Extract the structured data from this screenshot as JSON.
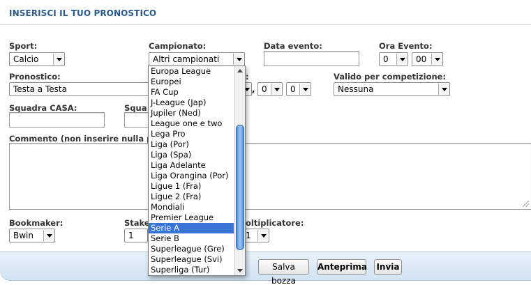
{
  "header": {
    "title": "INSERISCI IL TUO PRONOSTICO"
  },
  "row1": {
    "sport_label": "Sport:",
    "sport_value": "Calcio",
    "campionato_label": "Campionato:",
    "campionato_value": "Altri campionati",
    "data_label": "Data evento:",
    "data_value": "",
    "ora_label": "Ora Evento:",
    "ora_hour": "0",
    "ora_minute": "00"
  },
  "row2": {
    "pronostico_label": "Pronostico:",
    "pronostico_value": "Testa a Testa",
    "quota_int_partial": "",
    "quota_sep": ",",
    "quota_dec1": "0",
    "quota_dec2": "0",
    "valido_label": "Valido per competizione:",
    "valido_value": "Nessuna"
  },
  "row3": {
    "casa_label": "Squadra CASA:",
    "ospite_label_partial": "Squa"
  },
  "commento": {
    "label": "Commento (non inserire nulla pe"
  },
  "row4": {
    "bookmaker_label": "Bookmaker:",
    "bookmaker_value": "Bwin",
    "stake_label_partial": "Stake",
    "stake_value": "1",
    "molt_label_partial": "oltiplicatore:",
    "molt_value": "1"
  },
  "footer": {
    "salva_bozza": "Salva bozza",
    "anteprima": "Anteprima",
    "invia": "Invia"
  },
  "dropdown": {
    "items": [
      "Europa League",
      "Europei",
      "FA Cup",
      "J-League (Jap)",
      "Jupiler (Ned)",
      "League one e two",
      "Lega Pro",
      "Liga (Por)",
      "Liga (Spa)",
      "Liga Adelante",
      "Liga Orangina (Por)",
      "Ligue 1 (Fra)",
      "Ligue 2 (Fra)",
      "Mondiali",
      "Premier League",
      "Serie A",
      "Serie B",
      "Superleague (Gre)",
      "Superleague (Svi)",
      "Superliga (Tur)"
    ],
    "selected": "Serie A"
  },
  "colors": {
    "title": "#2a5a8c",
    "selection": "#3875d7",
    "footer_bg": "#d2e3f3"
  }
}
